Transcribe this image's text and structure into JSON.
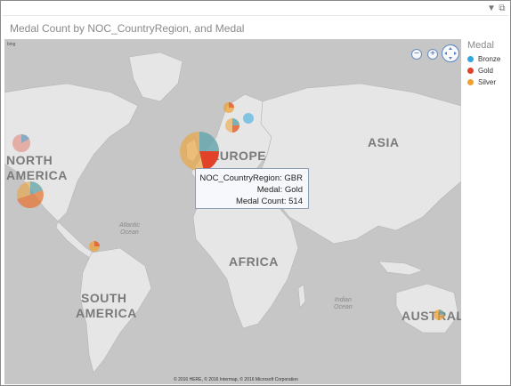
{
  "visual": {
    "title": "Medal Count by NOC_CountryRegion, and Medal",
    "filter_icon": "filter-icon",
    "focus_icon": "focus-mode-icon"
  },
  "map": {
    "labels": {
      "north": "NORTH",
      "america": "AMERICA",
      "europe": "EUROPE",
      "asia": "ASIA",
      "africa": "AFRICA",
      "south": "SOUTH",
      "south_america": "AMERICA",
      "australia": "AUSTRALIA",
      "atlantic_1": "Atlantic",
      "atlantic_2": "Ocean",
      "indian_1": "Indian",
      "indian_2": "Ocean"
    },
    "copyright": "© 2016 HERE, © 2016 Intermap, © 2016 Microsoft Corporation",
    "bing_mark": "bing",
    "controls": {
      "zoom_out": "−",
      "zoom_in": "+",
      "pan_icon": "pan-icon"
    }
  },
  "legend": {
    "title": "Medal",
    "items": [
      {
        "label": "Bronze",
        "color": "#2ea8df"
      },
      {
        "label": "Gold",
        "color": "#e0432a"
      },
      {
        "label": "Silver",
        "color": "#f0a030"
      }
    ]
  },
  "tooltip": {
    "rows": [
      {
        "key": "NOC_CountryRegion",
        "value": "GBR"
      },
      {
        "key": "Medal",
        "value": "Gold"
      },
      {
        "key": "Medal Count",
        "value": "514"
      }
    ]
  }
}
